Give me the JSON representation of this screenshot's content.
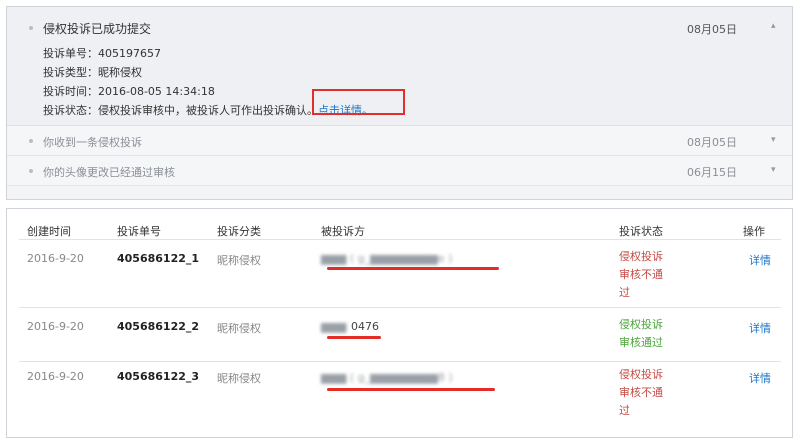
{
  "notifications": {
    "expanded": {
      "title": "侵权投诉已成功提交",
      "date": "08月05日",
      "lines": {
        "number": "投诉单号：405197657",
        "type": "投诉类型：昵称侵权",
        "time": "投诉时间：2016-08-05 14:34:18",
        "status_prefix": "投诉状态：侵权投诉审核中，被投诉人可作出投诉确认。",
        "status_link": "点击详情。"
      }
    },
    "items": [
      {
        "title": "你收到一条侵权投诉",
        "date": "08月05日"
      },
      {
        "title": "你的头像更改已经通过审核",
        "date": "06月15日"
      }
    ],
    "chevron_up": "▴",
    "chevron_down": "▾"
  },
  "table": {
    "headers": {
      "created": "创建时间",
      "number": "投诉单号",
      "category": "投诉分类",
      "respondent": "被投诉方",
      "status": "投诉状态",
      "action": "操作"
    },
    "rows": [
      {
        "date": "2016-9-20",
        "number": "405686122_1",
        "category": "昵称侵权",
        "respondent_visible": "",
        "respondent_blurred": "▆▆▆ ( g_▆▆▆▆▆▆▆▆e )",
        "status": [
          "侵权投诉",
          "审核不通",
          "过"
        ],
        "status_kind": "fail",
        "action": "详情"
      },
      {
        "date": "2016-9-20",
        "number": "405686122_2",
        "category": "昵称侵权",
        "respondent_visible": "0476",
        "respondent_blurred": "▆▆▆",
        "status": [
          "侵权投诉",
          "审核通过"
        ],
        "status_kind": "pass",
        "action": "详情"
      },
      {
        "date": "2016-9-20",
        "number": "405686122_3",
        "category": "昵称侵权",
        "respondent_visible": "",
        "respondent_blurred": "▆▆▆ ( g_▆▆▆▆▆▆▆▆8 )",
        "status": [
          "侵权投诉",
          "审核不通",
          "过"
        ],
        "status_kind": "fail",
        "action": "详情"
      }
    ]
  },
  "colors": {
    "link": "#1a73c9",
    "status_fail": "#c64b45",
    "status_pass": "#4aa53a",
    "highlight": "#e0302b"
  }
}
